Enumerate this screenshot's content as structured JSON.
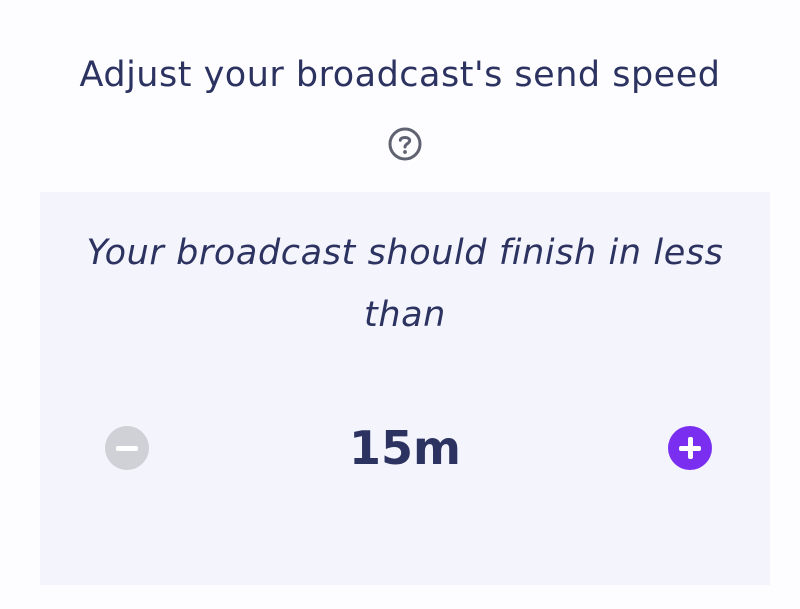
{
  "header": {
    "title": "Adjust your broadcast's send speed",
    "help_icon": "question-circle-icon"
  },
  "panel": {
    "subtitle": "Your broadcast should finish in less than",
    "duration_value": "15m",
    "decrement_icon": "minus-circle-icon",
    "increment_icon": "plus-circle-icon",
    "decrement_enabled": false,
    "increment_enabled": true
  },
  "colors": {
    "text": "#2c3360",
    "panel_bg": "#f4f5fc",
    "accent": "#7a2ff0",
    "disabled": "#d0d1d7"
  }
}
